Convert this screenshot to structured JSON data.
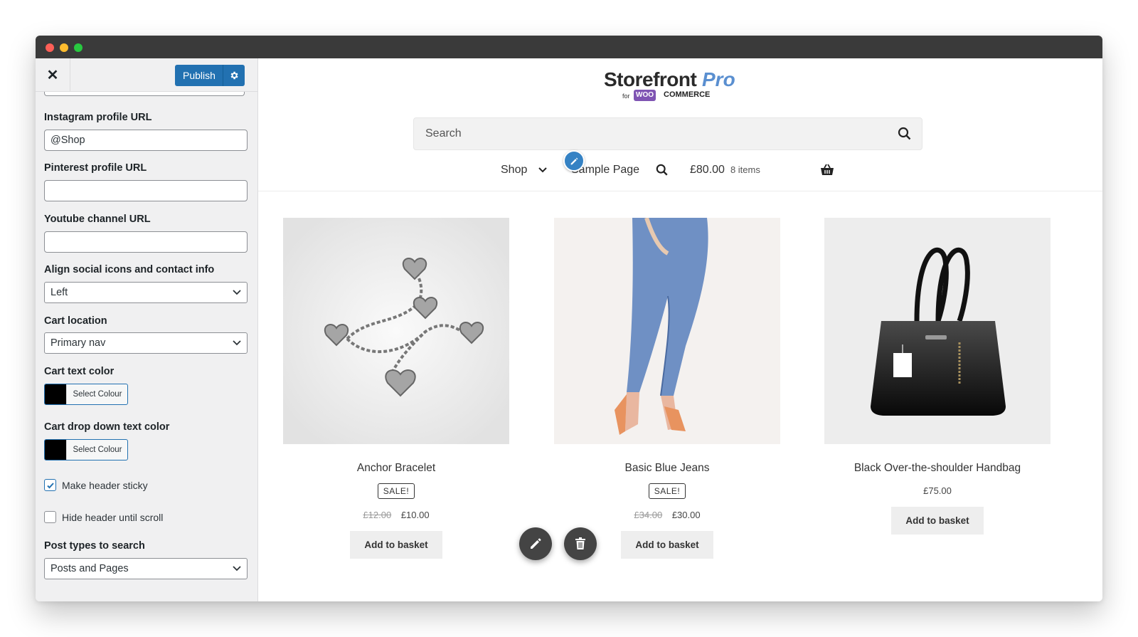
{
  "customizer": {
    "publish_label": "Publish",
    "fields": {
      "instagram_label": "Instagram profile URL",
      "instagram_value": "@Shop",
      "pinterest_label": "Pinterest profile URL",
      "pinterest_value": "",
      "youtube_label": "Youtube channel URL",
      "youtube_value": "",
      "align_label": "Align social icons and contact info",
      "align_value": "Left",
      "cart_location_label": "Cart location",
      "cart_location_value": "Primary nav",
      "cart_text_color_label": "Cart text color",
      "cart_text_color_button": "Select Colour",
      "cart_text_color_value": "#000000",
      "cart_dropdown_color_label": "Cart drop down text color",
      "cart_dropdown_color_button": "Select Colour",
      "cart_dropdown_color_value": "#000000",
      "sticky_label": "Make header sticky",
      "sticky_checked": true,
      "hide_header_label": "Hide header until scroll",
      "hide_header_checked": false,
      "post_types_label": "Post types to search",
      "post_types_value": "Posts and Pages"
    }
  },
  "store": {
    "logo_main": "Storefront",
    "logo_pro": "Pro",
    "logo_for": "for",
    "logo_woo": "WOO",
    "logo_commerce": "COMMERCE",
    "search_placeholder": "Search",
    "nav": {
      "shop": "Shop",
      "sample_page": "Sample Page",
      "cart_total": "£80.00",
      "cart_count": "8 items"
    },
    "products": [
      {
        "name": "Anchor Bracelet",
        "sale_badge": "SALE!",
        "old_price": "£12.00",
        "price": "£10.00",
        "button": "Add to basket"
      },
      {
        "name": "Basic Blue Jeans",
        "sale_badge": "SALE!",
        "old_price": "£34.00",
        "price": "£30.00",
        "button": "Add to basket"
      },
      {
        "name": "Black Over-the-shoulder Handbag",
        "price": "£75.00",
        "button": "Add to basket"
      }
    ]
  },
  "colors": {
    "accent": "#2271b1",
    "edit_pin": "#3582c4",
    "fab": "#444444"
  }
}
